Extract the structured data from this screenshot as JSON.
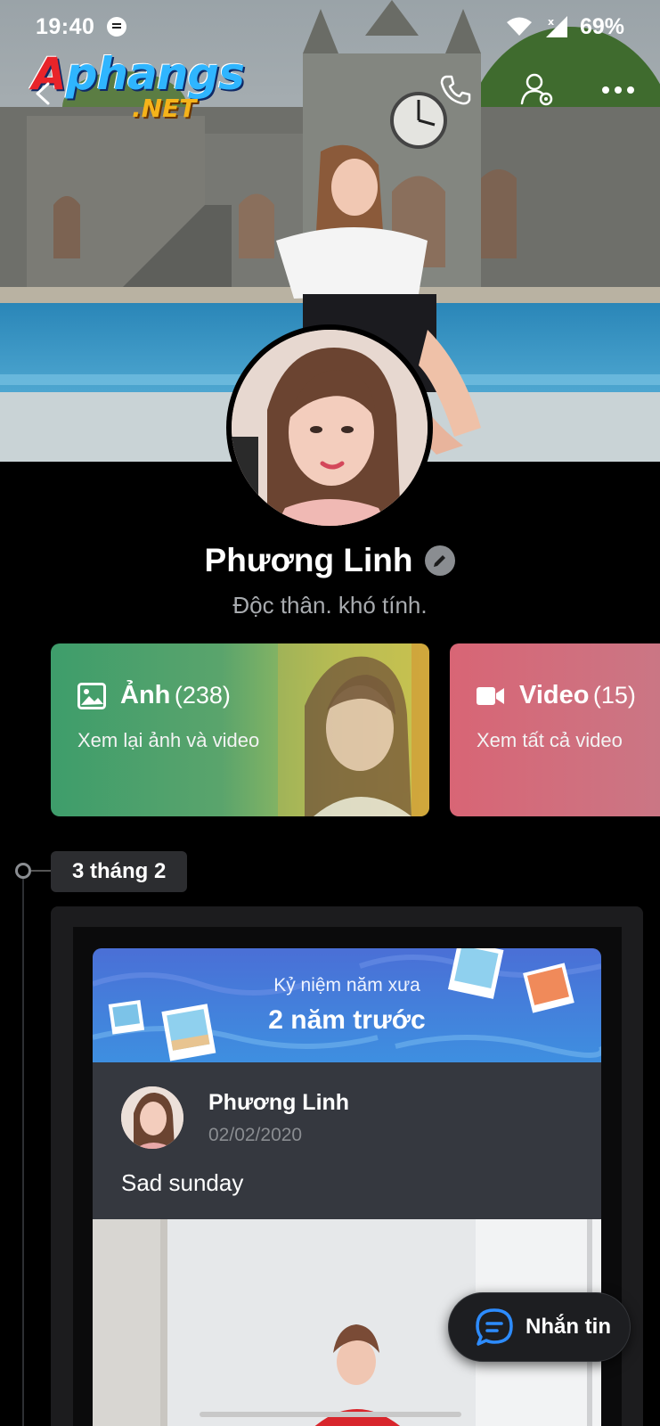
{
  "status_bar": {
    "time": "19:40",
    "battery": "69%"
  },
  "watermark": {
    "top": "Aphangs",
    "bottom": ".NET"
  },
  "top_actions": {
    "icons": [
      "back-arrow-icon",
      "phone-icon",
      "user-settings-icon",
      "more-icon"
    ]
  },
  "profile": {
    "name": "Phương Linh",
    "bio": "Độc thân. khó tính."
  },
  "media_cards": {
    "photos": {
      "title": "Ảnh",
      "count": "(238)",
      "subtitle": "Xem lại ảnh và video"
    },
    "videos": {
      "title": "Video",
      "count": "(15)",
      "subtitle": "Xem tất cả video"
    }
  },
  "timeline": {
    "date": "3 tháng 2",
    "memory": {
      "label": "Kỷ niệm năm xưa",
      "years": "2 năm trước"
    },
    "post": {
      "author": "Phương Linh",
      "date": "02/02/2020",
      "text": "Sad sunday"
    }
  },
  "fab": {
    "label": "Nhắn tin"
  },
  "colors": {
    "background": "#000000",
    "photo_card": "#3e9d6b",
    "video_card": "#d86575",
    "memory_banner": "#4a6fd6",
    "accent_blue": "#2d8cff"
  }
}
